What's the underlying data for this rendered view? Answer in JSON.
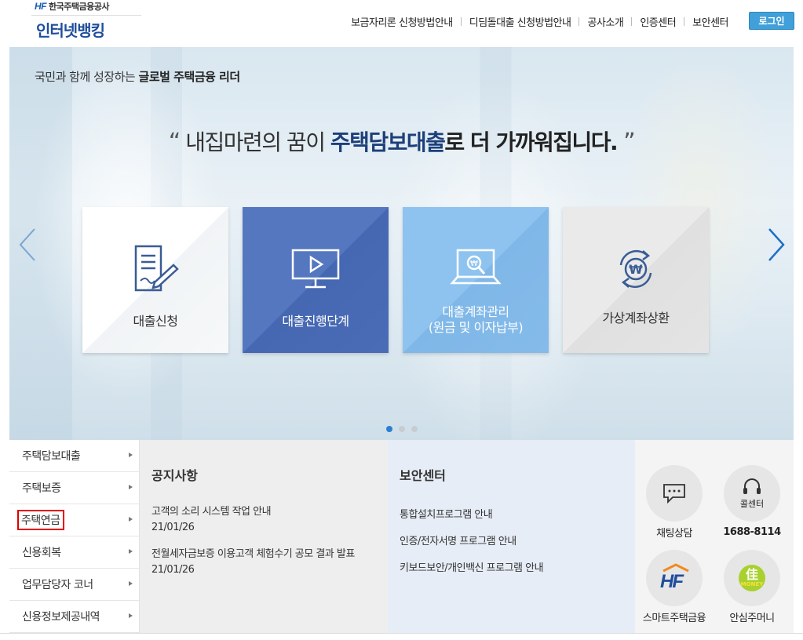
{
  "header": {
    "logo_hf": "HF",
    "logo_org": "한국주택금융공사",
    "logo_title": "인터넷뱅킹",
    "nav": [
      "보금자리론 신청방법안내",
      "디딤돌대출 신청방법안내",
      "공사소개",
      "인증센터",
      "보안센터"
    ],
    "login_label": "로그인",
    "login_color": "#41a0d9"
  },
  "hero": {
    "tagline_plain": "국민과 함께 성장하는 ",
    "tagline_bold": "글로벌 주택금융 리더",
    "quote_open": "“",
    "quote_pre": " 내집마련의 꿈이 ",
    "quote_highlight": "주택담보대출",
    "quote_post": "로 더 가까워집니다.",
    "quote_close": " ”",
    "cards": [
      {
        "label": "대출신청",
        "icon": "document-pen-icon"
      },
      {
        "label": "대출진행단계",
        "icon": "monitor-play-icon"
      },
      {
        "label_line1": "대출계좌관리",
        "label_line2": "(원금 및 이자납부)",
        "icon": "laptop-won-search-icon"
      },
      {
        "label": "가상계좌상환",
        "icon": "won-refresh-icon"
      }
    ],
    "slide_count": 3,
    "active_slide": 1
  },
  "sidemenu": {
    "items": [
      "주택담보대출",
      "주택보증",
      "주택연금",
      "신용회복",
      "업무담당자 코너",
      "신용정보제공내역"
    ]
  },
  "notice": {
    "title": "공지사항",
    "items": [
      {
        "title": "고객의 소리 시스템 작업 안내",
        "date": "21/01/26"
      },
      {
        "title": "전월세자금보증 이용고객 체험수기 공모 결과 발표",
        "date": "21/01/26"
      }
    ]
  },
  "security": {
    "title": "보안센터",
    "items": [
      "통합설치프로그램 안내",
      "인증/전자서명 프로그램 안내",
      "키보드보안/개인백신 프로그램 안내"
    ]
  },
  "quick": {
    "chat_label": "채팅상담",
    "call_icon_label": "콜센터",
    "call_number": "1688-8114",
    "smart_logo": "HF",
    "smart_label": "스마트주택금융",
    "money_logo_main": "佳",
    "money_logo_sub": "MONEY",
    "money_label": "안심주머니"
  }
}
